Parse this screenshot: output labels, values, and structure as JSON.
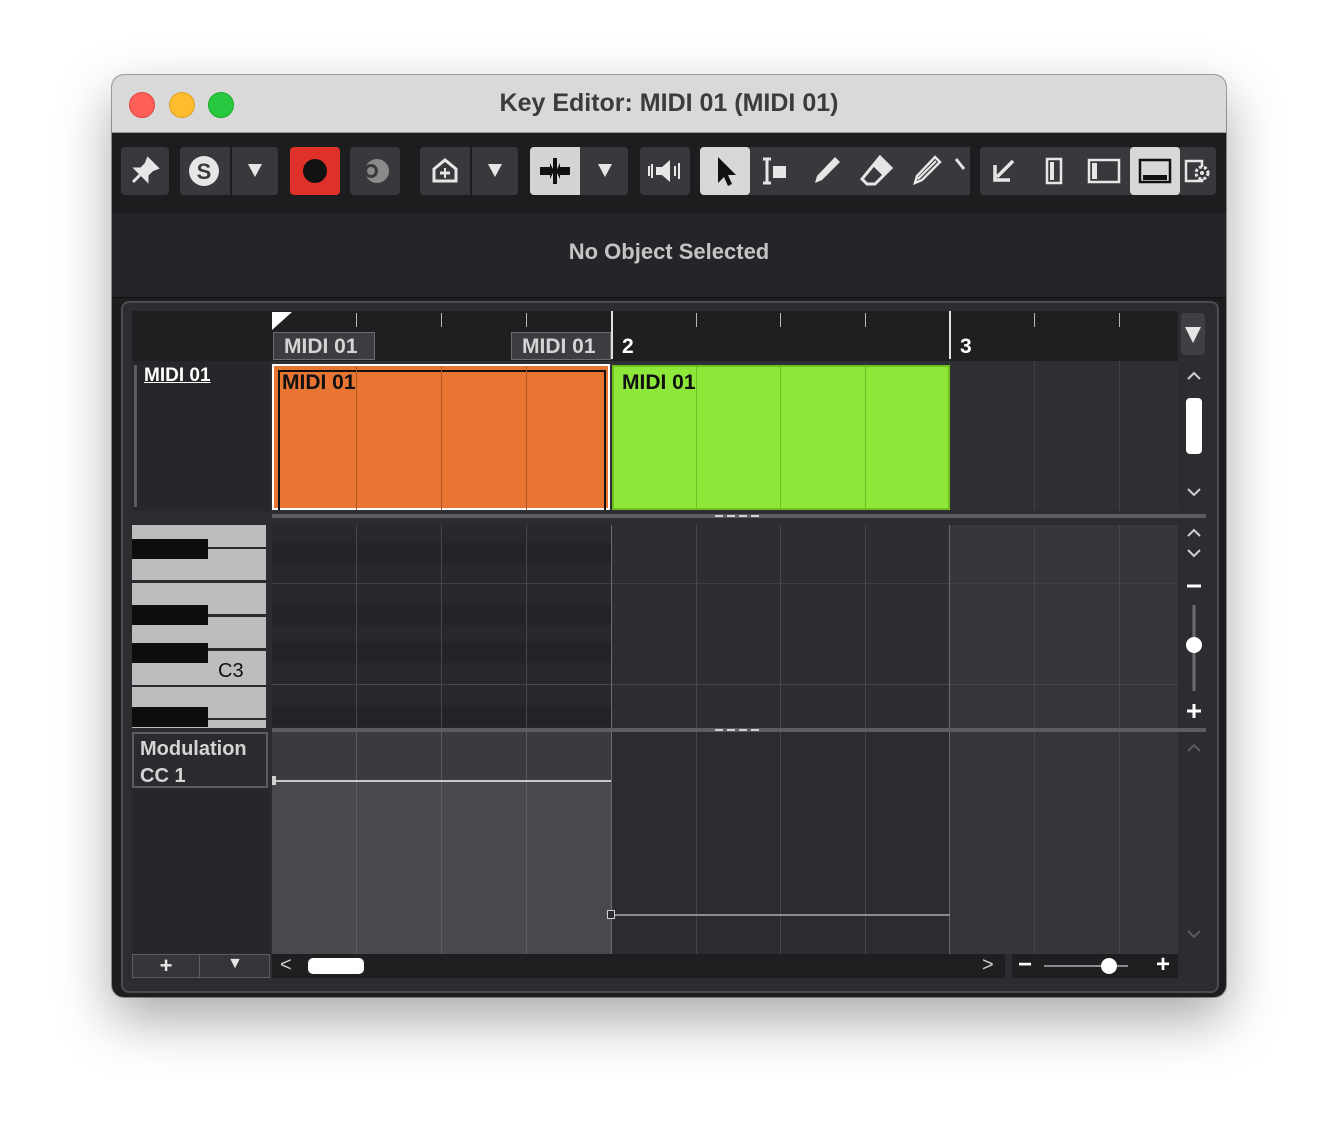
{
  "window": {
    "title": "Key Editor: MIDI 01 (MIDI 01)",
    "traffic_lights": {
      "close": "#ff5f57",
      "minimize": "#febc2e",
      "zoom": "#28c840"
    }
  },
  "toolbar": {
    "icons": [
      "pin-icon",
      "solo-icon",
      "record-icon",
      "monitor-icon",
      "auto-scroll-icon",
      "snap-icon",
      "speaker-icon",
      "pointer-icon",
      "range-select-icon",
      "draw-icon",
      "erase-icon",
      "line-icon",
      "left-zone-icon",
      "info-zone-icon",
      "inspector-zone-icon",
      "lower-zone-icon",
      "settings-icon"
    ],
    "solo_letter": "S",
    "record_color": "#e0302a",
    "active_tool": "pointer"
  },
  "info_line": {
    "text": "No Object Selected"
  },
  "ruler": {
    "container_labels": [
      "MIDI 01",
      "MIDI 01"
    ],
    "bar_numbers": [
      "2",
      "3"
    ]
  },
  "track": {
    "name": "MIDI 01",
    "parts": [
      {
        "label": "MIDI 01",
        "color": "#e87632",
        "selected": true
      },
      {
        "label": "MIDI 01",
        "color": "#8ee83a",
        "selected": false
      }
    ]
  },
  "keyboard": {
    "note_label": "C3"
  },
  "controller_lane": {
    "name": "Modulation",
    "cc": "CC 1",
    "values": [
      0.98,
      0.23
    ]
  },
  "bottom": {
    "add_label": "+",
    "menu_label": "▼",
    "scroll_left": "<",
    "scroll_right": ">",
    "zoom_out": "−",
    "zoom_in": "+"
  }
}
